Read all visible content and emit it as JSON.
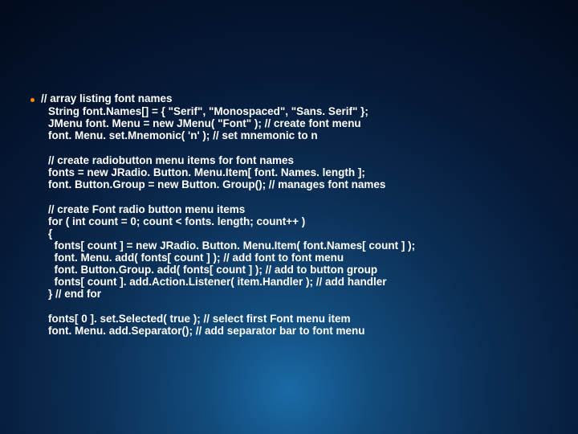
{
  "code": {
    "b1l1": "// array listing font names",
    "b1l2": "String font.Names[] = { \"Serif\", \"Monospaced\", \"Sans. Serif\" };",
    "b1l3": "JMenu font. Menu = new JMenu( \"Font\" ); // create font menu",
    "b1l4": "font. Menu. set.Mnemonic( 'n' ); // set mnemonic to n",
    "b2l1": "// create radiobutton menu items for font names",
    "b2l2": "fonts = new JRadio. Button. Menu.Item[ font. Names. length ];",
    "b2l3": "font. Button.Group = new Button. Group(); // manages font names",
    "b3l1": "// create Font radio button menu items",
    "b3l2": "for ( int count = 0; count < fonts. length; count++ )",
    "b3l3": "{",
    "b3l4": "  fonts[ count ] = new JRadio. Button. Menu.Item( font.Names[ count ] );",
    "b3l5": "  font. Menu. add( fonts[ count ] ); // add font to font menu",
    "b3l6": "  font. Button.Group. add( fonts[ count ] ); // add to button group",
    "b3l7": "  fonts[ count ]. add.Action.Listener( item.Handler ); // add handler",
    "b3l8": "} // end for",
    "b4l1": "fonts[ 0 ]. set.Selected( true ); // select first Font menu item",
    "b4l2": "font. Menu. add.Separator(); // add separator bar to font menu"
  }
}
